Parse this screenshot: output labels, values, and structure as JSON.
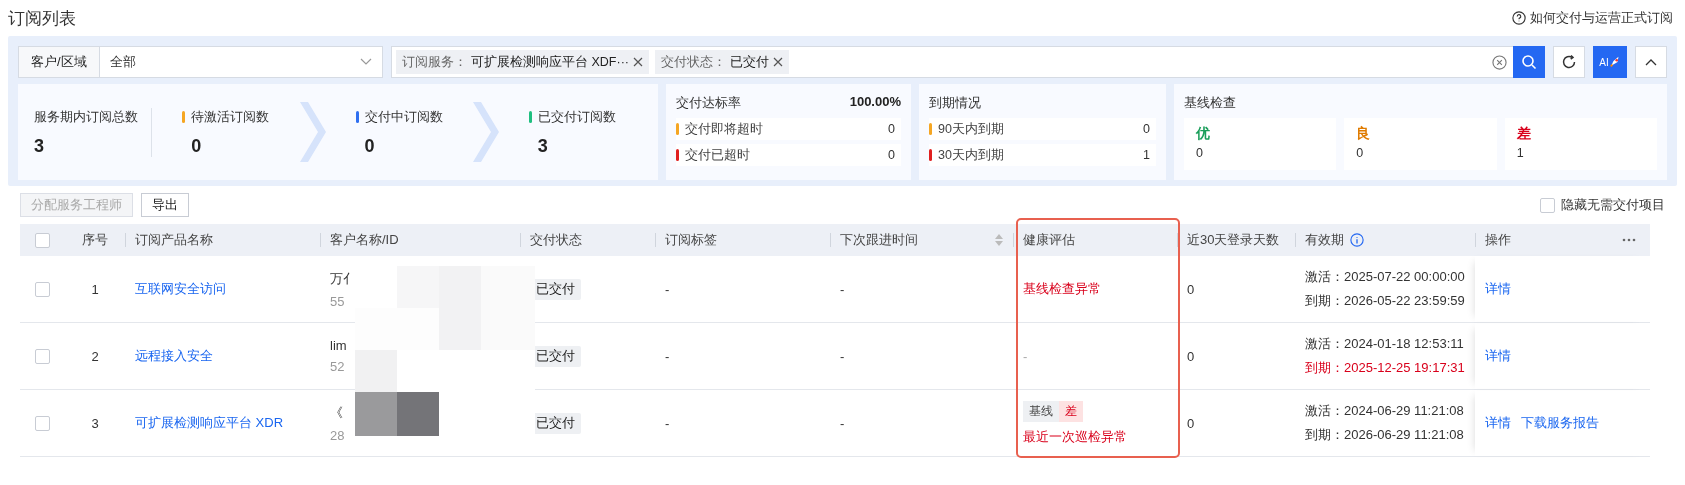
{
  "title": "订阅列表",
  "help_link": "如何交付与运营正式订阅",
  "filter": {
    "region_label": "客户/区域",
    "region_value": "全部",
    "chips": [
      {
        "label": "订阅服务：",
        "value": "可扩展检测响应平台 XDF···"
      },
      {
        "label": "交付状态：",
        "value": "已交付"
      }
    ],
    "ai_button": "AI"
  },
  "funnel": [
    {
      "label": "服务期内订阅总数",
      "value": "3"
    },
    {
      "label": "待激活订阅数",
      "value": "0",
      "color": "#f5a623"
    },
    {
      "label": "交付中订阅数",
      "value": "0",
      "color": "#2f6ff0"
    },
    {
      "label": "已交付订阅数",
      "value": "3",
      "color": "#1fbf80"
    }
  ],
  "delivery": {
    "title": "交付达标率",
    "rate": "100.00%",
    "items": [
      {
        "label": "交付即将超时",
        "value": "0",
        "color": "#f5a623"
      },
      {
        "label": "交付已超时",
        "value": "0",
        "color": "#e02020"
      }
    ]
  },
  "expiry": {
    "title": "到期情况",
    "items": [
      {
        "label": "90天内到期",
        "value": "0",
        "color": "#f5a623"
      },
      {
        "label": "30天内到期",
        "value": "1",
        "color": "#e02020"
      }
    ]
  },
  "baseline": {
    "title": "基线检查",
    "items": [
      {
        "label": "优",
        "value": "0",
        "color": "#1a9e5a"
      },
      {
        "label": "良",
        "value": "0",
        "color": "#e07b00"
      },
      {
        "label": "差",
        "value": "1",
        "color": "#d9001b"
      }
    ]
  },
  "toolbar": {
    "assign_button": {
      "label": "分配服务工程师",
      "disabled": true
    },
    "export_button": "导出",
    "hide_checkbox": {
      "label": "隐藏无需交付项目",
      "checked": false
    }
  },
  "table": {
    "select_all_checked": false,
    "columns": [
      "序号",
      "订阅产品名称",
      "客户名称/ID",
      "交付状态",
      "订阅标签",
      "下次跟进时间",
      "健康评估",
      "近30天登录天数",
      "有效期",
      "操作"
    ],
    "rows": [
      {
        "checked": false,
        "index": "1",
        "product": "互联网安全访问",
        "customer": "万亻",
        "customer_id": "55",
        "status": "已交付",
        "tag": "-",
        "next_follow": "-",
        "health": {
          "kind": "alert",
          "text": "基线检查异常"
        },
        "login_days": "0",
        "activate": "激活：2025-07-22 00:00:00",
        "expire": "到期：2026-05-22 23:59:59",
        "expire_warning": false,
        "actions": [
          "详情"
        ]
      },
      {
        "checked": false,
        "index": "2",
        "product": "远程接入安全",
        "customer": "lim",
        "customer_id": "52",
        "status": "已交付",
        "tag": "-",
        "next_follow": "-",
        "health": {
          "kind": "none",
          "text": "-"
        },
        "login_days": "0",
        "activate": "激活：2024-01-18 12:53:11",
        "expire": "到期：2025-12-25 19:17:31",
        "expire_warning": true,
        "actions": [
          "详情"
        ]
      },
      {
        "checked": false,
        "index": "3",
        "product": "可扩展检测响应平台 XDR",
        "customer": "《",
        "customer_id": "28",
        "status": "已交付",
        "tag": "-",
        "next_follow": "-",
        "health": {
          "kind": "tagged",
          "tag": "基线",
          "grade": "差",
          "text": "最近一次巡检异常"
        },
        "login_days": "0",
        "activate": "激活：2024-06-29 11:21:08",
        "expire": "到期：2026-06-29 11:21:08",
        "expire_warning": false,
        "actions": [
          "详情",
          "下载服务报告"
        ]
      }
    ]
  }
}
